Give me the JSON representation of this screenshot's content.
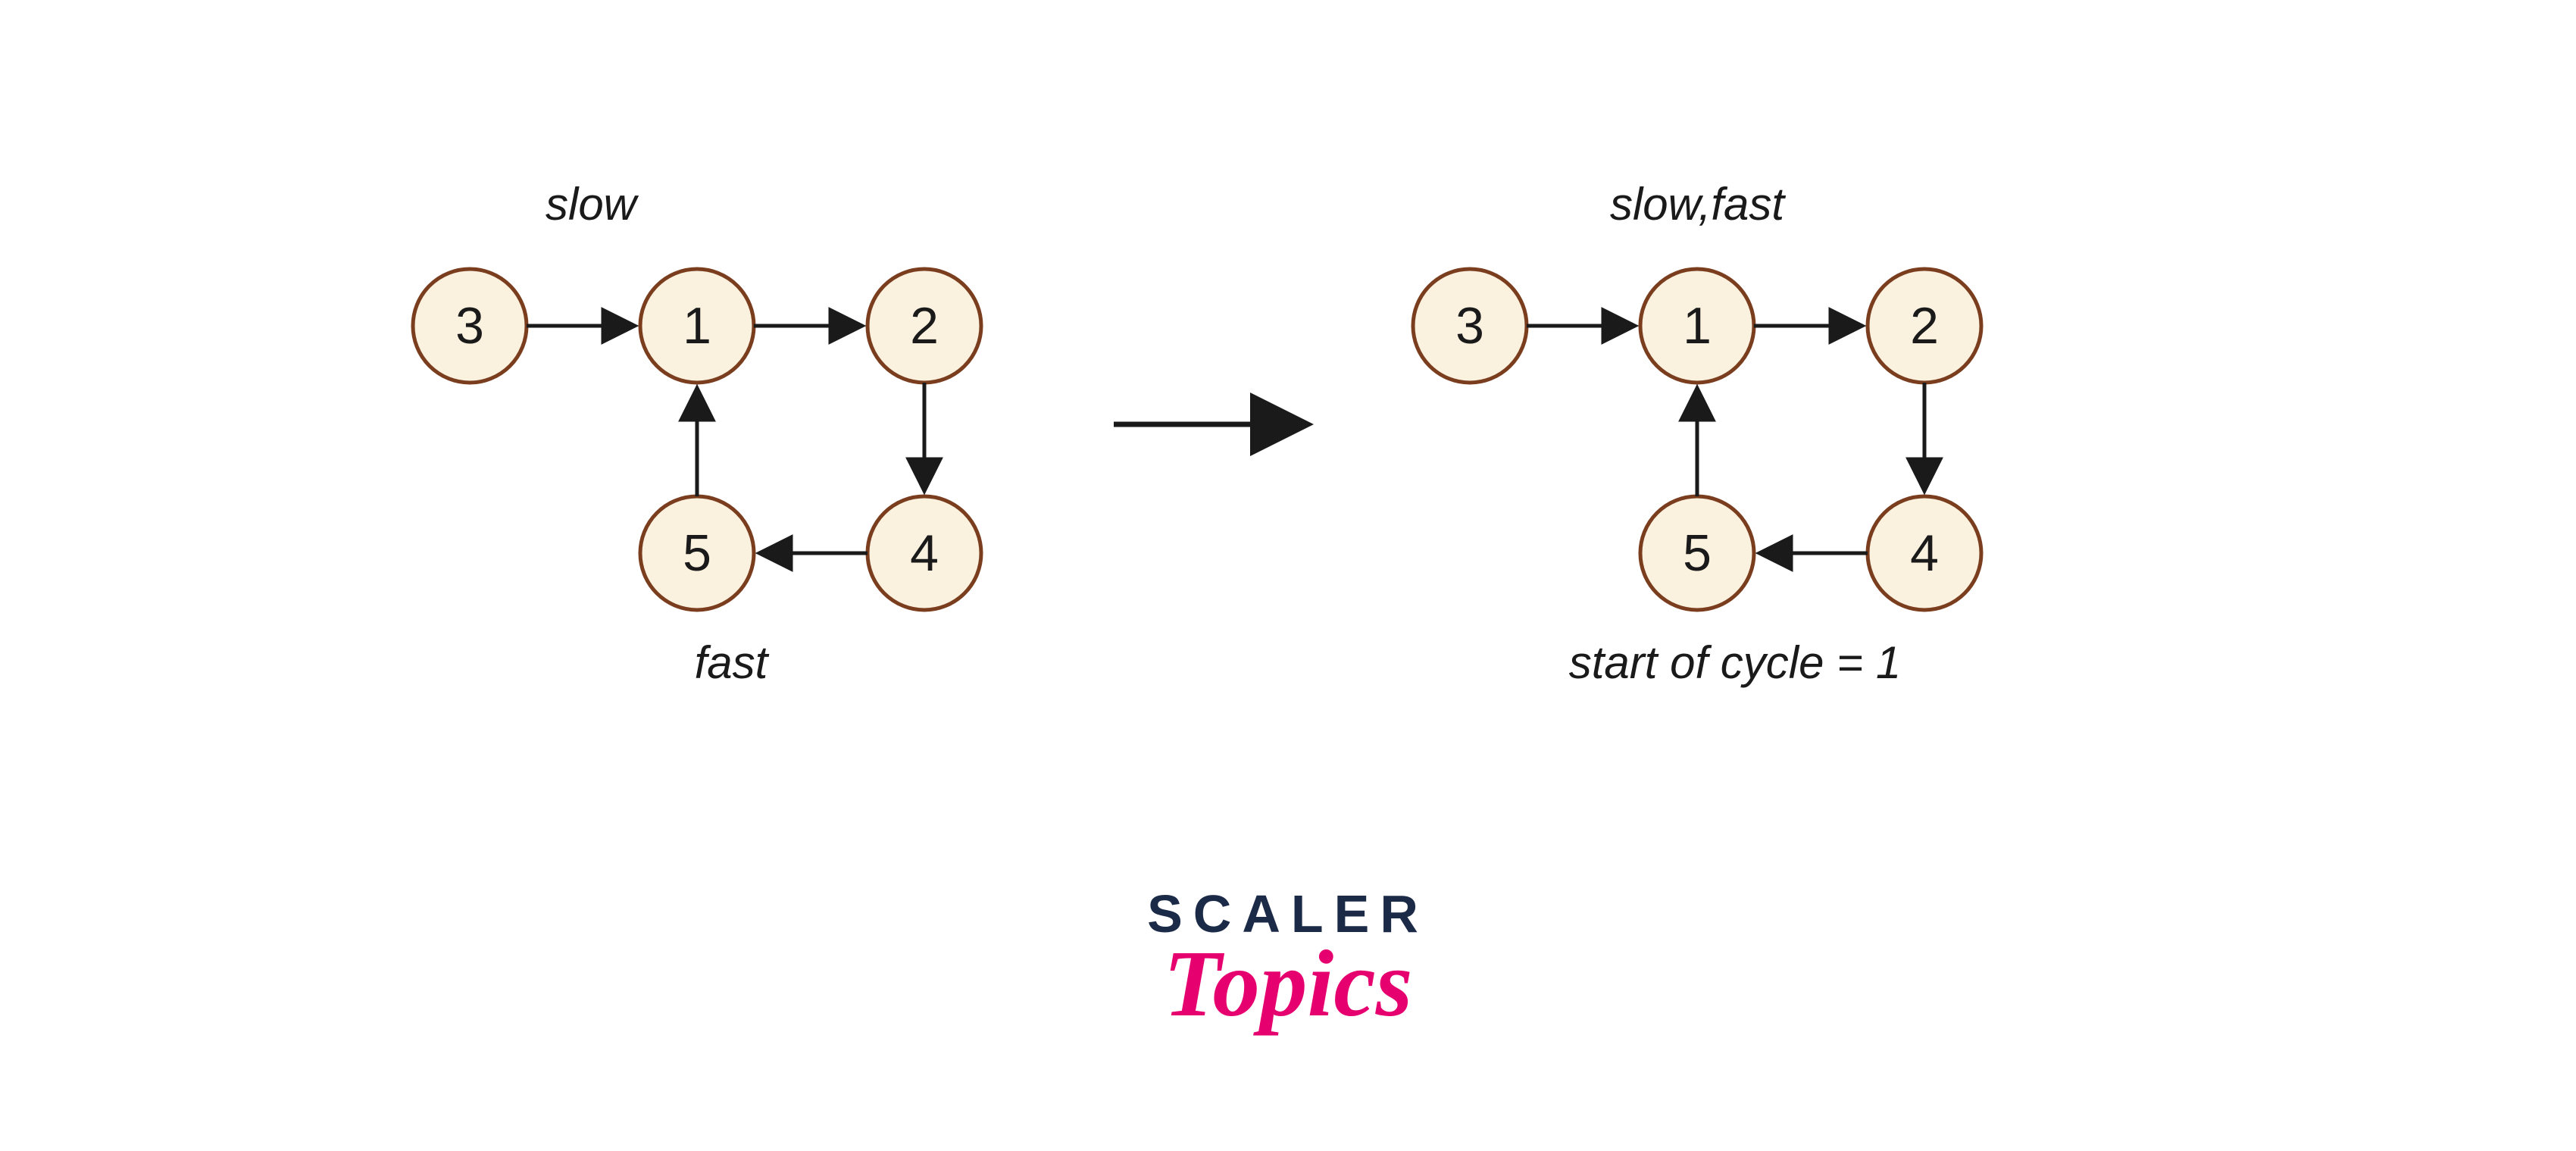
{
  "diagram": {
    "left": {
      "topLabel": "slow",
      "bottomLabel": "fast",
      "nodes": {
        "n3": "3",
        "n1": "1",
        "n2": "2",
        "n5": "5",
        "n4": "4"
      }
    },
    "right": {
      "topLabel": "slow,fast",
      "bottomLabel": "start of cycle = 1",
      "nodes": {
        "n3": "3",
        "n1": "1",
        "n2": "2",
        "n5": "5",
        "n4": "4"
      }
    }
  },
  "logo": {
    "line1": "SCALER",
    "line2": "Topics"
  }
}
